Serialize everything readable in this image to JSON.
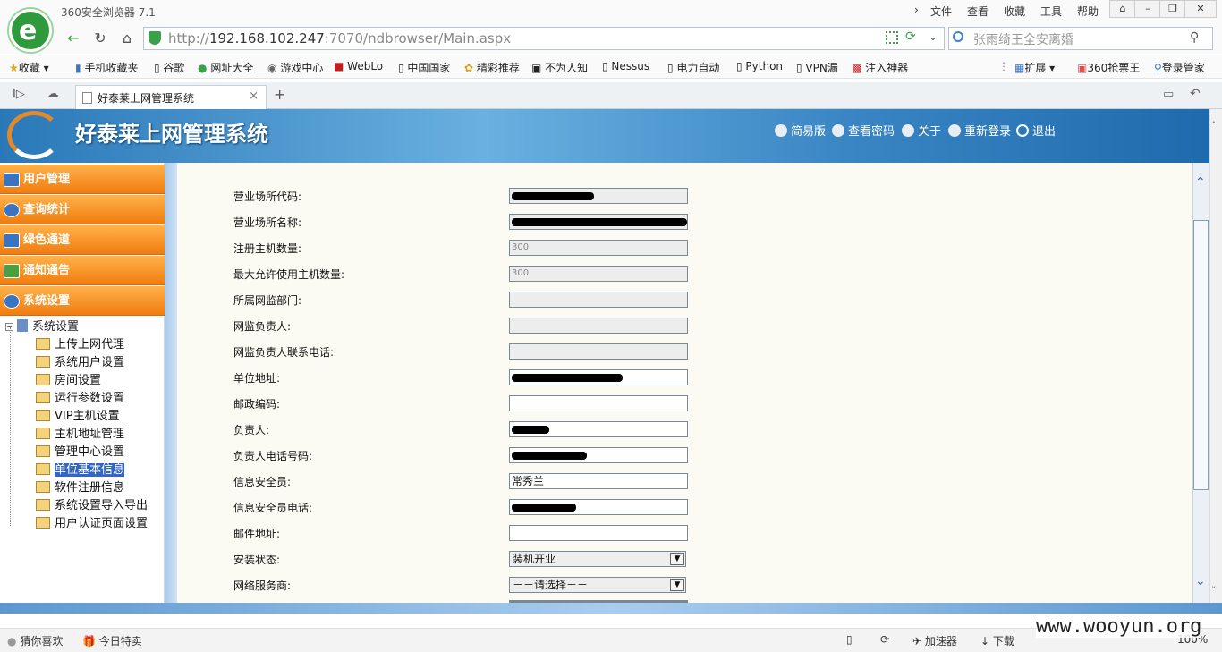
{
  "browser": {
    "title": "360安全浏览器 7.1",
    "menu": [
      "文件",
      "查看",
      "收藏",
      "工具",
      "帮助"
    ],
    "url_prefix": "http://",
    "url_host": "192.168.102.247",
    "url_rest": ":7070/ndbrowser/Main.aspx",
    "search_text": "张雨绮王全安离婚",
    "bookmarks": [
      "收藏",
      "手机收藏夹",
      "谷歌",
      "网址大全",
      "游戏中心",
      "WebLo",
      "中国国家",
      "精彩推荐",
      "不为人知",
      "Nessus",
      "电力自动",
      "Python",
      "VPN漏",
      "注入神器"
    ],
    "bookmarks_right": [
      "扩展",
      "360抢票王",
      "登录管家"
    ],
    "tab_title": "好泰莱上网管理系统",
    "tab_close": "×",
    "new_tab": "+"
  },
  "app": {
    "title": "好泰莱上网管理系统",
    "header_links": [
      "简易版",
      "查看密码",
      "关于",
      "重新登录",
      "退出"
    ]
  },
  "sidebar": {
    "sections": [
      "用户管理",
      "查询统计",
      "绿色通道",
      "通知通告",
      "系统设置"
    ],
    "tree_root": "系统设置",
    "tree_items": [
      "上传上网代理",
      "系统用户设置",
      "房间设置",
      "运行参数设置",
      "VIP主机设置",
      "主机地址管理",
      "管理中心设置",
      "单位基本信息",
      "软件注册信息",
      "系统设置导入导出",
      "用户认证页面设置"
    ],
    "selected": "单位基本信息"
  },
  "form": {
    "fields": [
      {
        "label": "营业场所代码:",
        "value": ""
      },
      {
        "label": "营业场所名称:",
        "value": ""
      },
      {
        "label": "注册主机数量:",
        "value": "300"
      },
      {
        "label": "最大允许使用主机数量:",
        "value": "300"
      },
      {
        "label": "所属网监部门:",
        "value": ""
      },
      {
        "label": "网监负责人:",
        "value": ""
      },
      {
        "label": "网监负责人联系电话:",
        "value": ""
      },
      {
        "label": "单位地址:",
        "value": ""
      },
      {
        "label": "邮政编码:",
        "value": ""
      },
      {
        "label": "负责人:",
        "value": ""
      },
      {
        "label": "负责人电话号码:",
        "value": ""
      },
      {
        "label": "信息安全员:",
        "value": "常秀兰"
      },
      {
        "label": "信息安全员电话:",
        "value": ""
      },
      {
        "label": "邮件地址:",
        "value": ""
      },
      {
        "label": "安装状态:",
        "value": "装机开业"
      },
      {
        "label": "网络服务商:",
        "value": "－－请选择－－"
      }
    ]
  },
  "statusbar": {
    "left": [
      "猜你喜欢",
      "今日特卖"
    ],
    "right": [
      "加速器",
      "下载",
      "100%"
    ]
  },
  "watermark": "www.wooyun.org"
}
